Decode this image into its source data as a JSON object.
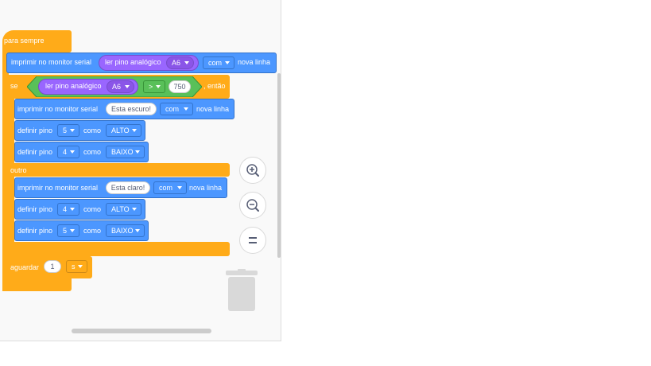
{
  "blocks": {
    "forever_label": "para sempre",
    "print1": {
      "label": "imprimir no monitor serial",
      "reporter_label": "ler pino analógico",
      "pin": "A6",
      "mode": "com",
      "suffix": "nova linha"
    },
    "if_label": "se",
    "if_reporter_label": "ler pino analógico",
    "if_pin": "A6",
    "if_operator": ">",
    "if_value": "750",
    "then_label": ", então",
    "print2": {
      "label": "imprimir no monitor serial",
      "text": "Esta escuro!",
      "mode": "com",
      "suffix": "nova linha"
    },
    "set1": {
      "label": "definir pino",
      "pin": "5",
      "como": "como",
      "value": "ALTO"
    },
    "set2": {
      "label": "definir pino",
      "pin": "4",
      "como": "como",
      "value": "BAIXO"
    },
    "else_label": "outro",
    "print3": {
      "label": "imprimir no monitor serial",
      "text": "Esta claro!",
      "mode": "com",
      "suffix": "nova linha"
    },
    "set3": {
      "label": "definir pino",
      "pin": "4",
      "como": "como",
      "value": "ALTO"
    },
    "set4": {
      "label": "definir pino",
      "pin": "5",
      "como": "como",
      "value": "BAIXO"
    },
    "wait": {
      "label": "aguardar",
      "value": "1",
      "unit": "s"
    }
  },
  "zoom": {
    "zoom_in": "zoom-in-icon",
    "zoom_out": "zoom-out-icon",
    "reset": "equals-icon"
  },
  "colors": {
    "control": "#ffab19",
    "action": "#4c97ff",
    "sensor": "#9966ff",
    "operator": "#59c059"
  }
}
